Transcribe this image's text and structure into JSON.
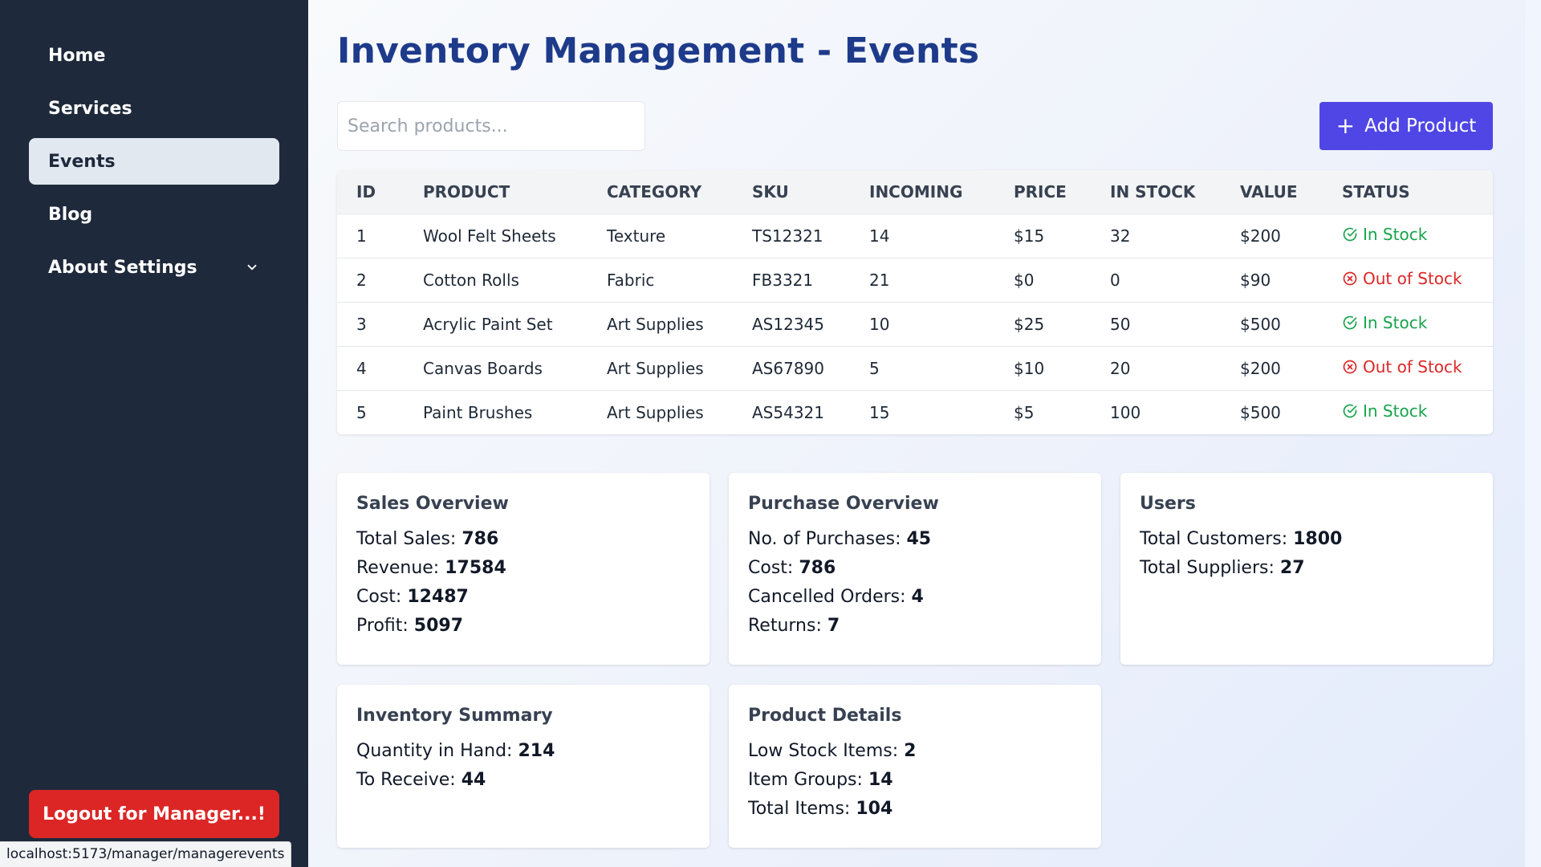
{
  "sidebar": {
    "items": [
      {
        "label": "Home"
      },
      {
        "label": "Services"
      },
      {
        "label": "Events"
      },
      {
        "label": "Blog"
      },
      {
        "label": "About Settings"
      }
    ],
    "active": "Events",
    "logout_label": "Logout for Manager...!"
  },
  "status_bar": {
    "url": "localhost:5173/manager/managerevents"
  },
  "header": {
    "title": "Inventory Management - Events"
  },
  "search": {
    "placeholder": "Search products..."
  },
  "toolbar": {
    "add_label": "Add Product",
    "add_icon": "plus-icon"
  },
  "table": {
    "columns": [
      "ID",
      "Product",
      "Category",
      "SKU",
      "Incoming",
      "Price",
      "In Stock",
      "Value",
      "Status"
    ],
    "rows": [
      {
        "id": "1",
        "product": "Wool Felt Sheets",
        "category": "Texture",
        "sku": "TS12321",
        "incoming": "14",
        "price": "$15",
        "in_stock": "32",
        "value": "$200",
        "status": "In Stock"
      },
      {
        "id": "2",
        "product": "Cotton Rolls",
        "category": "Fabric",
        "sku": "FB3321",
        "incoming": "21",
        "price": "$0",
        "in_stock": "0",
        "value": "$90",
        "status": "Out of Stock"
      },
      {
        "id": "3",
        "product": "Acrylic Paint Set",
        "category": "Art Supplies",
        "sku": "AS12345",
        "incoming": "10",
        "price": "$25",
        "in_stock": "50",
        "value": "$500",
        "status": "In Stock"
      },
      {
        "id": "4",
        "product": "Canvas Boards",
        "category": "Art Supplies",
        "sku": "AS67890",
        "incoming": "5",
        "price": "$10",
        "in_stock": "20",
        "value": "$200",
        "status": "Out of Stock"
      },
      {
        "id": "5",
        "product": "Paint Brushes",
        "category": "Art Supplies",
        "sku": "AS54321",
        "incoming": "15",
        "price": "$5",
        "in_stock": "100",
        "value": "$500",
        "status": "In Stock"
      }
    ]
  },
  "cards": {
    "sales": {
      "title": "Sales Overview",
      "lines": [
        {
          "label": "Total Sales:",
          "value": "786"
        },
        {
          "label": "Revenue:",
          "value": "17584"
        },
        {
          "label": "Cost:",
          "value": "12487"
        },
        {
          "label": "Profit:",
          "value": "5097"
        }
      ]
    },
    "purchase": {
      "title": "Purchase Overview",
      "lines": [
        {
          "label": "No. of Purchases:",
          "value": "45"
        },
        {
          "label": "Cost:",
          "value": "786"
        },
        {
          "label": "Cancelled Orders:",
          "value": "4"
        },
        {
          "label": "Returns:",
          "value": "7"
        }
      ]
    },
    "users": {
      "title": "Users",
      "lines": [
        {
          "label": "Total Customers:",
          "value": "1800"
        },
        {
          "label": "Total Suppliers:",
          "value": "27"
        }
      ]
    },
    "inventory": {
      "title": "Inventory Summary",
      "lines": [
        {
          "label": "Quantity in Hand:",
          "value": "214"
        },
        {
          "label": "To Receive:",
          "value": "44"
        }
      ]
    },
    "product": {
      "title": "Product Details",
      "lines": [
        {
          "label": "Low Stock Items:",
          "value": "2"
        },
        {
          "label": "Item Groups:",
          "value": "14"
        },
        {
          "label": "Total Items:",
          "value": "104"
        }
      ]
    }
  },
  "colors": {
    "sidebar_bg": "#1e293b",
    "active_nav_bg": "#e2e8f0",
    "title": "#1e3a8a",
    "accent": "#4f46e5",
    "logout": "#dc2626",
    "in_stock": "#16a34a",
    "out_of_stock": "#dc2626"
  }
}
